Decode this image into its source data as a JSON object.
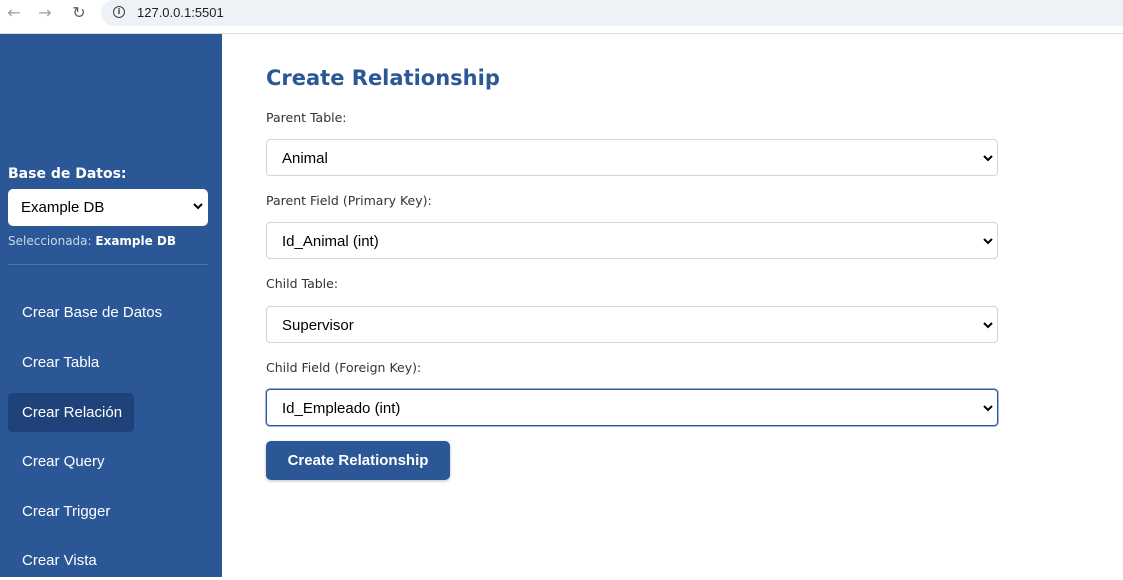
{
  "browser": {
    "url": "127.0.0.1:5501",
    "icons": [
      "back-arrow-icon",
      "forward-arrow-icon",
      "reload-icon",
      "info-icon"
    ]
  },
  "sidebar": {
    "db_label": "Base de Datos:",
    "db_select_value": "Example DB",
    "selected_prefix": "Seleccionada: ",
    "selected_name": "Example DB",
    "items": [
      {
        "label": "Crear Base de Datos",
        "active": false
      },
      {
        "label": "Crear Tabla",
        "active": false
      },
      {
        "label": "Crear Relación",
        "active": true
      },
      {
        "label": "Crear Query",
        "active": false
      },
      {
        "label": "Crear Trigger",
        "active": false
      },
      {
        "label": "Crear Vista",
        "active": false
      }
    ]
  },
  "main": {
    "title": "Create Relationship",
    "fields": [
      {
        "label": "Parent Table:",
        "value": "Animal"
      },
      {
        "label": "Parent Field (Primary Key):",
        "value": "Id_Animal (int)"
      },
      {
        "label": "Child Table:",
        "value": "Supervisor"
      },
      {
        "label": "Child Field (Foreign Key):",
        "value": "Id_Empleado (int)"
      }
    ],
    "submit_label": "Create Relationship"
  },
  "colors": {
    "sidebar_bg": "#2b5797",
    "active_item_bg": "#1e4279",
    "title_color": "#2b5797",
    "button_bg": "#2b5797"
  }
}
